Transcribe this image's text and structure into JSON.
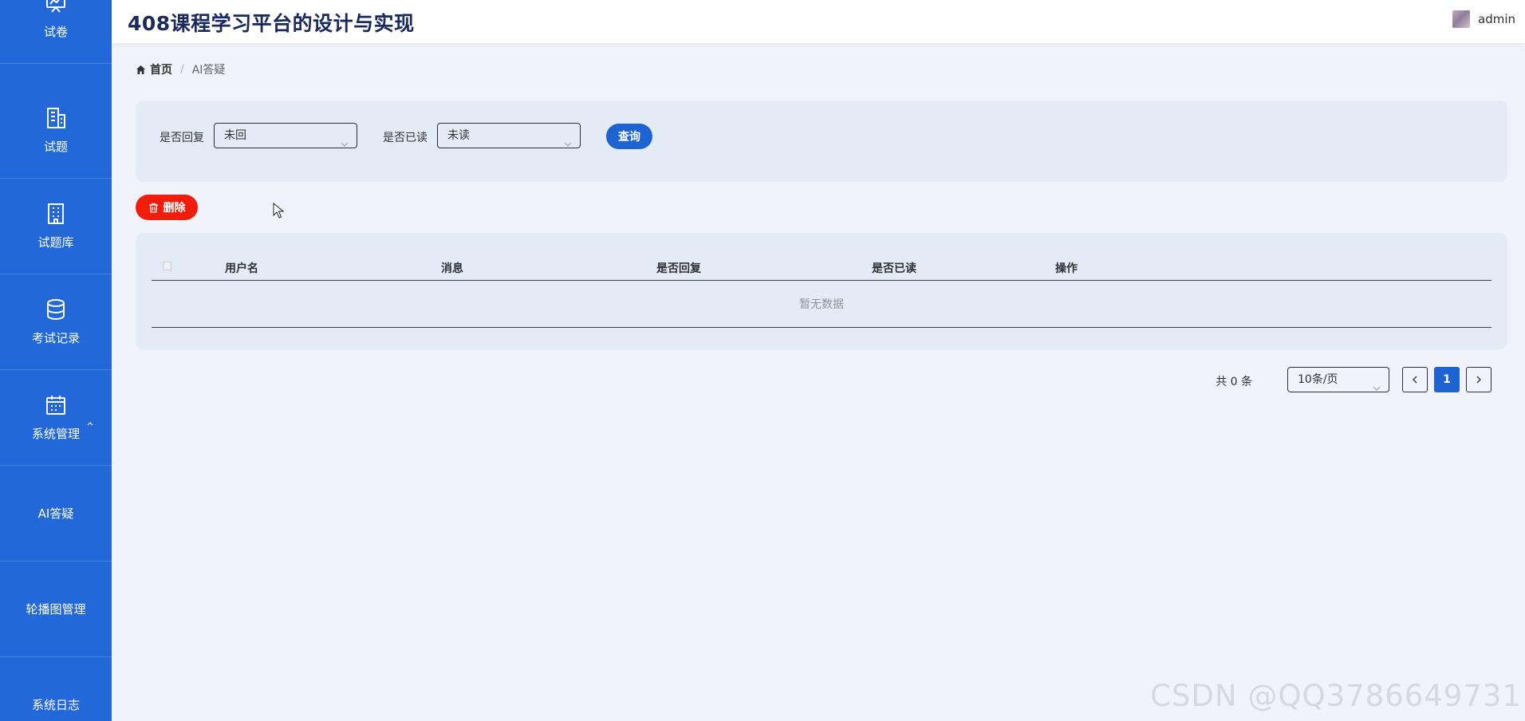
{
  "header": {
    "title": "408课程学习平台的设计与实现",
    "user_name": "admin"
  },
  "sidebar": {
    "items": [
      {
        "label": "试卷",
        "icon": "chart-board-icon"
      },
      {
        "label": "试题",
        "icon": "building-icon"
      },
      {
        "label": "试题库",
        "icon": "office-building-icon"
      },
      {
        "label": "考试记录",
        "icon": "database-icon"
      },
      {
        "label": "系统管理",
        "icon": "calendar-icon"
      },
      {
        "label": "AI答疑"
      },
      {
        "label": "轮播图管理"
      },
      {
        "label": "系统日志"
      }
    ]
  },
  "breadcrumb": {
    "home": "首页",
    "separator": "/",
    "current": "AI答疑"
  },
  "filters": {
    "reply_label": "是否回复",
    "reply_value": "未回",
    "read_label": "是否已读",
    "read_value": "未读",
    "query_label": "查询"
  },
  "actions": {
    "delete_label": "删除"
  },
  "table": {
    "columns": [
      "用户名",
      "消息",
      "是否回复",
      "是否已读",
      "操作"
    ],
    "empty_text": "暂无数据"
  },
  "pagination": {
    "total_text": "共 0 条",
    "page_size": "10条/页",
    "current_page": "1"
  },
  "watermark": "CSDN @QQ3786649731",
  "colors": {
    "sidebar": "#2368d8",
    "primary": "#1e63d2",
    "danger": "#f01c0c",
    "panel": "#e3ebf6",
    "background": "#f0f3fa"
  }
}
